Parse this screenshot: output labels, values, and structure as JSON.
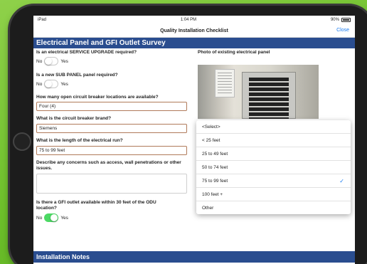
{
  "status": {
    "device": "iPad",
    "time": "1:04 PM",
    "battery": "90%"
  },
  "navbar": {
    "title": "Quality Installation Checklist",
    "close": "Close"
  },
  "section": {
    "title": "Electrical Panel and GFI Outlet Survey"
  },
  "questions": {
    "service_upgrade": {
      "label": "Is an electrical SERVICE UPGRADE required?",
      "no": "No",
      "yes": "Yes",
      "on": false
    },
    "sub_panel": {
      "label": "Is a new SUB PANEL panel required?",
      "no": "No",
      "yes": "Yes",
      "on": false
    },
    "open_breakers": {
      "label": "How many open circuit breaker locations are available?",
      "value": "Four (4)"
    },
    "breaker_brand": {
      "label": "What is the circuit breaker brand?",
      "value": "Siemens"
    },
    "electrical_run": {
      "label": "What is the length of the electrical run?",
      "value": "75 to 99 feet"
    },
    "concerns": {
      "label": "Describe any concerns such as access, wall penetrations or other issues.",
      "value": ""
    },
    "gfi_outlet": {
      "label": "Is there a GFI outlet available within 30 feet of the ODU location?",
      "no": "No",
      "yes": "Yes",
      "on": true
    }
  },
  "photo": {
    "label": "Photo of existing electrical panel"
  },
  "dropdown": {
    "options": [
      "<Select>",
      "< 25 feet",
      "25 to 49 feet",
      "50 to 74 feet",
      "75 to 99 feet",
      "100 feet +",
      "Other"
    ],
    "selected_index": 4
  },
  "footer": {
    "title": "Installation Notes"
  },
  "colors": {
    "header": "#2a4d8f",
    "accent": "#1a7cf0",
    "toggle_on": "#4cd964"
  }
}
